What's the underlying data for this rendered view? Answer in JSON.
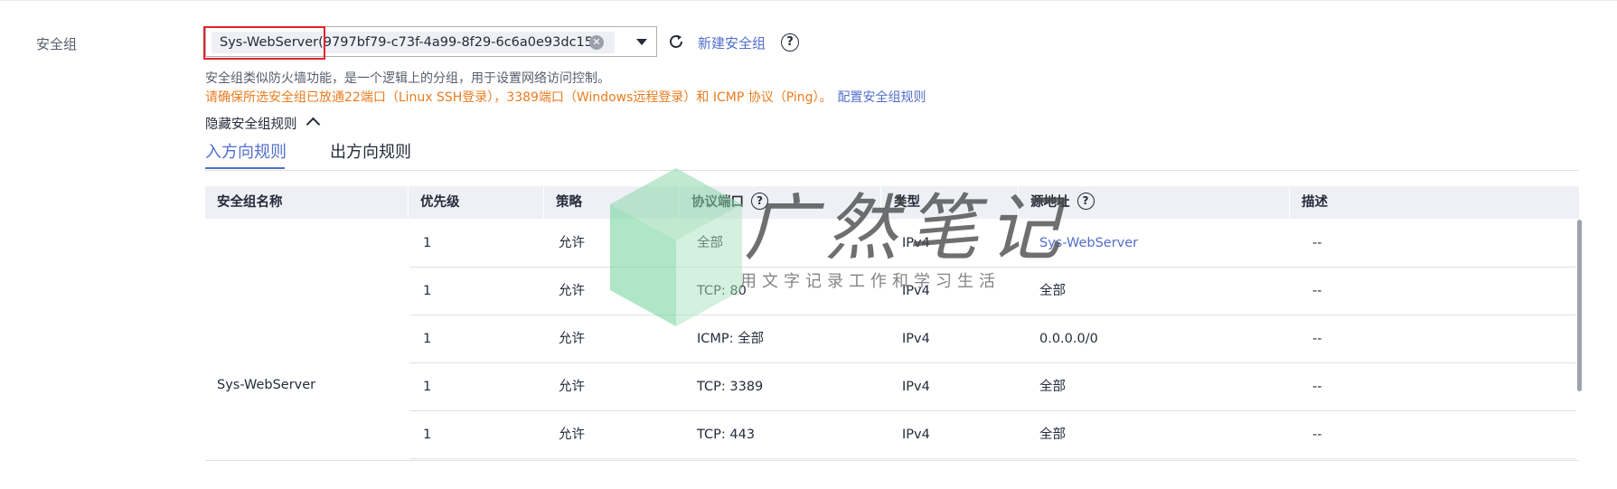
{
  "form": {
    "label": "安全组",
    "selected_value": "Sys-WebServer(9797bf79-c73f-4a99-8f29-6c6a0e93dc15)",
    "clear_glyph": "✕",
    "new_link": "新建安全组",
    "help_glyph": "?",
    "hint": "安全组类似防火墙功能，是一个逻辑上的分组，用于设置网络访问控制。",
    "warning": "请确保所选安全组已放通22端口（Linux SSH登录），3389端口（Windows远程登录）和 ICMP 协议（Ping）。",
    "config_link": "配置安全组规则",
    "toggle_label": "隐藏安全组规则"
  },
  "tabs": [
    {
      "label": "入方向规则",
      "active": true
    },
    {
      "label": "出方向规则",
      "active": false
    }
  ],
  "table": {
    "headers": [
      "安全组名称",
      "优先级",
      "策略",
      "协议端口",
      "类型",
      "源地址",
      "描述"
    ],
    "group_name": "Sys-WebServer",
    "rows": [
      [
        "1",
        "允许",
        "全部",
        "IPv4",
        "Sys-WebServer",
        "--"
      ],
      [
        "1",
        "允许",
        "TCP: 80",
        "IPv4",
        "全部",
        "--"
      ],
      [
        "1",
        "允许",
        "ICMP: 全部",
        "IPv4",
        "0.0.0.0/0",
        "--"
      ],
      [
        "1",
        "允许",
        "TCP: 3389",
        "IPv4",
        "全部",
        "--"
      ],
      [
        "1",
        "允许",
        "TCP: 443",
        "IPv4",
        "全部",
        "--"
      ]
    ]
  },
  "watermark": {
    "title": "广然笔记",
    "subtitle": "用文字记录工作和学习生活"
  },
  "colors": {
    "accent": "#526ecc",
    "warning": "#ea7c1f",
    "highlight": "#e0252b",
    "header_bg": "#eef0f5"
  }
}
